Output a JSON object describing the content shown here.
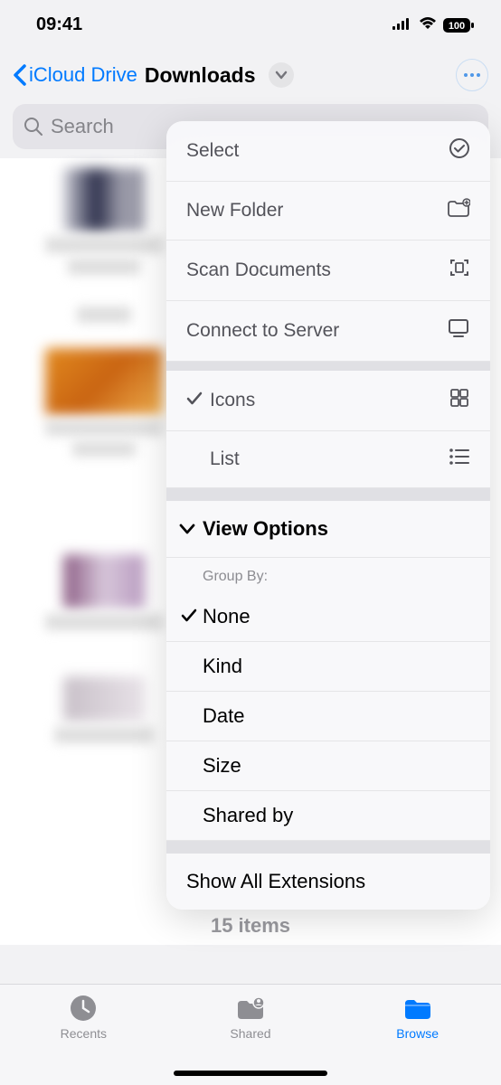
{
  "status": {
    "time": "09:41",
    "battery": "100"
  },
  "nav": {
    "back_label": "iCloud Drive",
    "title": "Downloads"
  },
  "search": {
    "placeholder": "Search"
  },
  "menu": {
    "select": "Select",
    "new_folder": "New Folder",
    "scan_docs": "Scan Documents",
    "connect_server": "Connect to Server",
    "icons": "Icons",
    "list": "List",
    "view_options": "View Options",
    "group_by_label": "Group By:",
    "group": {
      "none": "None",
      "kind": "Kind",
      "date": "Date",
      "size": "Size",
      "shared": "Shared by"
    },
    "show_ext": "Show All Extensions"
  },
  "footer": {
    "item_count": "15 items"
  },
  "tabs": {
    "recents": "Recents",
    "shared": "Shared",
    "browse": "Browse"
  }
}
